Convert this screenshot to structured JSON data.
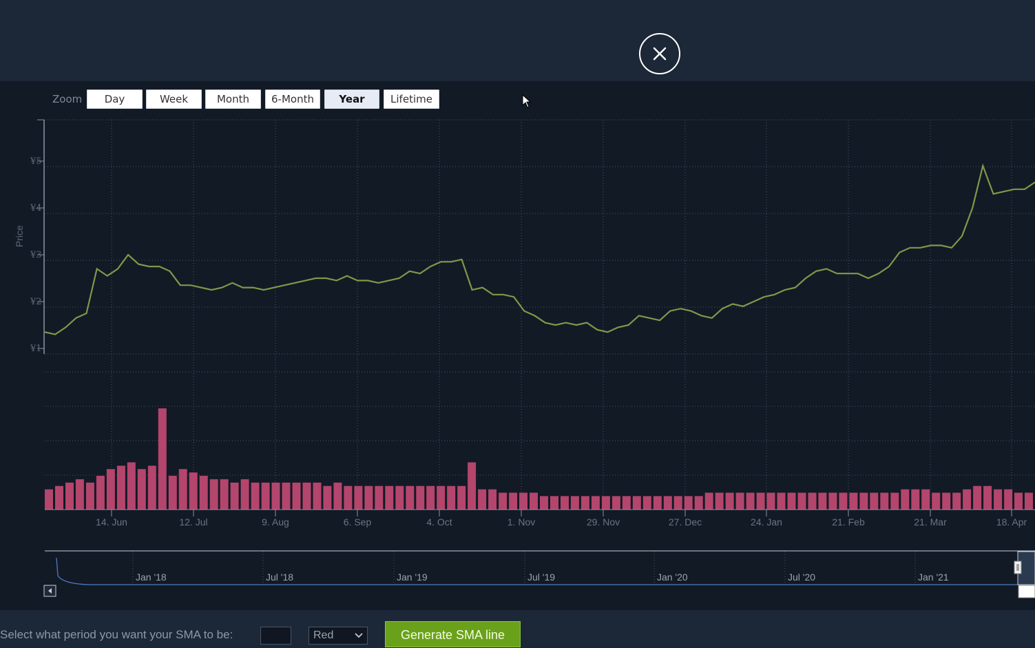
{
  "close": {
    "icon": "close-icon"
  },
  "zoom": {
    "label": "Zoom",
    "buttons": [
      "Day",
      "Week",
      "Month",
      "6-Month",
      "Year",
      "Lifetime"
    ],
    "active": "Year"
  },
  "sma": {
    "label": "Select what period you want your SMA to be:",
    "input_value": "",
    "color_selected": "Red",
    "generate_label": "Generate SMA line"
  },
  "colors": {
    "price_line": "#7d9a48",
    "volume_bar": "#b4456c",
    "navigator_line": "#4c7cc3",
    "grid": "#4a5566"
  },
  "chart_data": {
    "type": "line",
    "ylabel": "Price",
    "price_ticks": [
      "¥1",
      "¥2",
      "¥3",
      "¥4",
      "¥5"
    ],
    "ylim": [
      1,
      5.5
    ],
    "x_ticks": [
      "14. Jun",
      "12. Jul",
      "9. Aug",
      "6. Sep",
      "4. Oct",
      "1. Nov",
      "29. Nov",
      "27. Dec",
      "24. Jan",
      "21. Feb",
      "21. Mar",
      "18. Apr"
    ],
    "series": [
      {
        "values": [
          1.35,
          1.3,
          1.45,
          1.65,
          1.75,
          2.7,
          2.55,
          2.7,
          3.0,
          2.8,
          2.75,
          2.75,
          2.65,
          2.35,
          2.35,
          2.3,
          2.25,
          2.3,
          2.4,
          2.3,
          2.3,
          2.25,
          2.3,
          2.35,
          2.4,
          2.45,
          2.5,
          2.5,
          2.45,
          2.55,
          2.45,
          2.45,
          2.4,
          2.45,
          2.5,
          2.65,
          2.6,
          2.75,
          2.85,
          2.85,
          2.9,
          2.25,
          2.3,
          2.15,
          2.15,
          2.1,
          1.8,
          1.7,
          1.55,
          1.5,
          1.55,
          1.5,
          1.55,
          1.4,
          1.35,
          1.45,
          1.5,
          1.7,
          1.65,
          1.6,
          1.8,
          1.85,
          1.8,
          1.7,
          1.65,
          1.85,
          1.95,
          1.9,
          2.0,
          2.1,
          2.15,
          2.25,
          2.3,
          2.5,
          2.65,
          2.7,
          2.6,
          2.6,
          2.6,
          2.5,
          2.6,
          2.75,
          3.05,
          3.15,
          3.15,
          3.2,
          3.2,
          3.15,
          3.4,
          4.0,
          4.9,
          4.3,
          4.35,
          4.4,
          4.4,
          4.55
        ]
      }
    ],
    "volume": [
      6,
      7,
      8,
      9,
      8,
      10,
      12,
      13,
      14,
      12,
      13,
      30,
      10,
      12,
      11,
      10,
      9,
      9,
      8,
      9,
      8,
      8,
      8,
      8,
      8,
      8,
      8,
      7,
      8,
      7,
      7,
      7,
      7,
      7,
      7,
      7,
      7,
      7,
      7,
      7,
      7,
      14,
      6,
      6,
      5,
      5,
      5,
      5,
      4,
      4,
      4,
      4,
      4,
      4,
      4,
      4,
      4,
      4,
      4,
      4,
      4,
      4,
      4,
      4,
      5,
      5,
      5,
      5,
      5,
      5,
      5,
      5,
      5,
      5,
      5,
      5,
      5,
      5,
      5,
      5,
      5,
      5,
      5,
      6,
      6,
      6,
      5,
      5,
      5,
      6,
      7,
      7,
      6,
      6,
      5,
      5
    ],
    "navigator_ticks": [
      "Jan '18",
      "Jul '18",
      "Jan '19",
      "Jul '19",
      "Jan '20",
      "Jul '20",
      "Jan '21"
    ]
  }
}
